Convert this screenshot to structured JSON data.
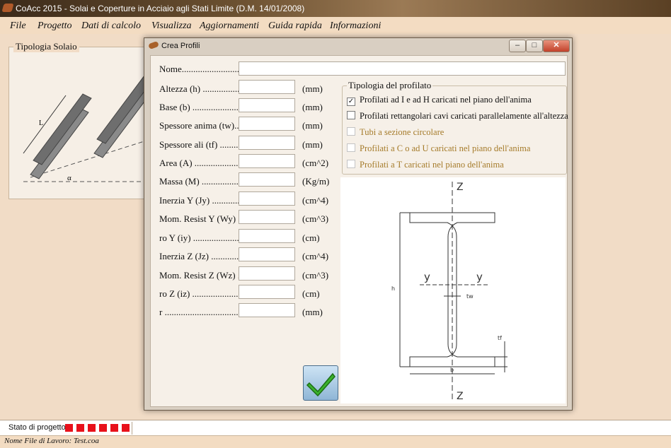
{
  "window": {
    "title": "CoAcc 2015 - Solai e Coperture in Acciaio agli Stati Limite (D.M. 14/01/2008)"
  },
  "menu": [
    "File",
    "Progetto",
    "Dati di calcolo",
    "Visualizza",
    "Aggiornamenti",
    "Guida rapida",
    "Informazioni"
  ],
  "background_panel": {
    "group_label": "Tipologia Solaio",
    "figure_labels": [
      "L",
      "α"
    ]
  },
  "dialog": {
    "title": "Crea Profili",
    "name_label": "Nome.........................",
    "name_value": "",
    "fields": [
      {
        "label": "Altezza (h) ....................",
        "unit": "(mm)",
        "value": ""
      },
      {
        "label": "Base (b) .........................",
        "unit": "(mm)",
        "value": ""
      },
      {
        "label": "Spessore anima (tw)....",
        "unit": "(mm)",
        "value": ""
      },
      {
        "label": "Spessore ali (tf) ...........",
        "unit": "(mm)",
        "value": ""
      },
      {
        "label": "Area (A) ........................",
        "unit": "(cm^2)",
        "value": ""
      },
      {
        "label": "Massa (M) ......................",
        "unit": "(Kg/m)",
        "value": ""
      },
      {
        "label": "Inerzia Y (Jy) .................",
        "unit": "(cm^4)",
        "value": ""
      },
      {
        "label": "Mom. Resist Y (Wy) ..",
        "unit": "(cm^3)",
        "value": ""
      },
      {
        "label": "ro Y (iy) .........................",
        "unit": "(cm)",
        "value": ""
      },
      {
        "label": "Inerzia Z (Jz) .................",
        "unit": "(cm^4)",
        "value": ""
      },
      {
        "label": "Mom. Resist Z (Wz) ..",
        "unit": "(cm^3)",
        "value": ""
      },
      {
        "label": "ro Z (iz) ..........................",
        "unit": "(cm)",
        "value": ""
      },
      {
        "label": "r .....................................",
        "unit": "(mm)",
        "value": ""
      }
    ],
    "type_group": {
      "title": "Tipologia del profilato",
      "options": [
        {
          "label": "Profilati ad I e ad H caricati nel piano dell'anima",
          "checked": true,
          "enabled": true
        },
        {
          "label": "Profilati rettangolari cavi caricati parallelamente all'altezza",
          "checked": false,
          "enabled": true
        },
        {
          "label": "Tubi a sezione circolare",
          "checked": false,
          "enabled": false
        },
        {
          "label": "Profilati a C o ad U caricati nel piano dell'anima",
          "checked": false,
          "enabled": false
        },
        {
          "label": "Profilati a T caricati nel piano dell'anima",
          "checked": false,
          "enabled": false
        }
      ]
    },
    "drawing_labels": {
      "z_top": "Z",
      "z_bottom": "Z",
      "y_left": "y",
      "y_right": "y",
      "h": "h",
      "b": "b",
      "tw": "tw",
      "tf": "tf"
    },
    "ok_icon": "checkmark-icon"
  },
  "status": {
    "progress_label": "Stato di progetto:",
    "progress_squares": 6,
    "square_color": "#e8111b",
    "file_label": "Nome File di Lavoro: Test.coa"
  }
}
